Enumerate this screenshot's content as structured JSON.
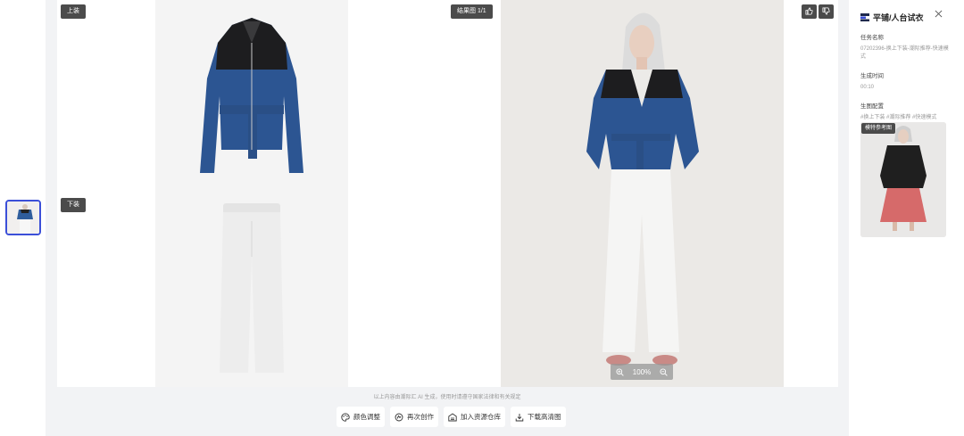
{
  "labels": {
    "top_tag": "上装",
    "bottom_tag": "下装",
    "result_tag": "结果图 1/1",
    "zoom_level": "100%"
  },
  "icons": {
    "like": "thumbs-up-icon",
    "dislike": "thumbs-down-icon",
    "zoom_in": "zoom-in-icon",
    "zoom_out": "zoom-out-icon",
    "close": "close-icon",
    "palette": "palette-icon",
    "recreate": "recreate-icon",
    "warehouse": "warehouse-icon",
    "download": "download-icon"
  },
  "footer": {
    "disclaimer": "以上内容由潮际汇 AI 生成，使用时请遵守国家法律和有关规定",
    "actions": [
      {
        "label": "颜色调整",
        "icon": "palette-icon"
      },
      {
        "label": "再次创作",
        "icon": "recreate-icon"
      },
      {
        "label": "加入资源仓库",
        "icon": "warehouse-icon"
      },
      {
        "label": "下载高清图",
        "icon": "download-icon"
      }
    ]
  },
  "side": {
    "title": "平铺/人台试衣",
    "task_label": "任务名称",
    "task_value": "07202396-换上下装-潮际推荐-快速模式",
    "time_label": "生成时间",
    "time_value": "00:10",
    "config_label": "生图配置",
    "config_value": "#换上下装 #潮际推荐 #快速模式",
    "ref_tag": "模特参考图"
  },
  "colors": {
    "accent": "#3b4fd8",
    "tag_bg": "#4b4b4b",
    "stage_bg": "#f2f3f5"
  }
}
